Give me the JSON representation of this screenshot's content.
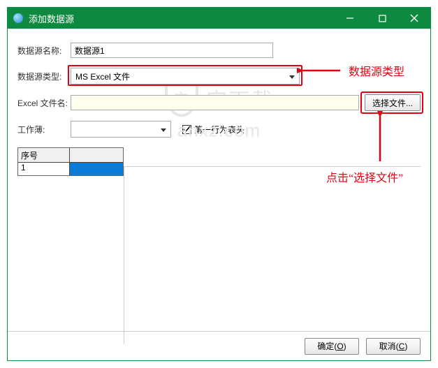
{
  "window": {
    "title": "添加数据源"
  },
  "fields": {
    "name_label": "数据源名称:",
    "name_value": "数据源1",
    "type_label": "数据源类型:",
    "type_value": "MS Excel 文件",
    "file_label": "Excel 文件名:",
    "file_value": "",
    "file_button": "选择文件...",
    "sheet_label": "工作薄:",
    "sheet_value": "",
    "header_checkbox_label": "第一行为表头",
    "header_checked": true
  },
  "grid": {
    "col1": "序号",
    "row1_col1": "1"
  },
  "buttons": {
    "ok": "确定(O)",
    "cancel": "取消(C)"
  },
  "annotations": {
    "type_label": "数据源类型",
    "click_file": "点击“选择文件”"
  },
  "watermark": {
    "text": "安下载",
    "url": "anxz.com"
  }
}
